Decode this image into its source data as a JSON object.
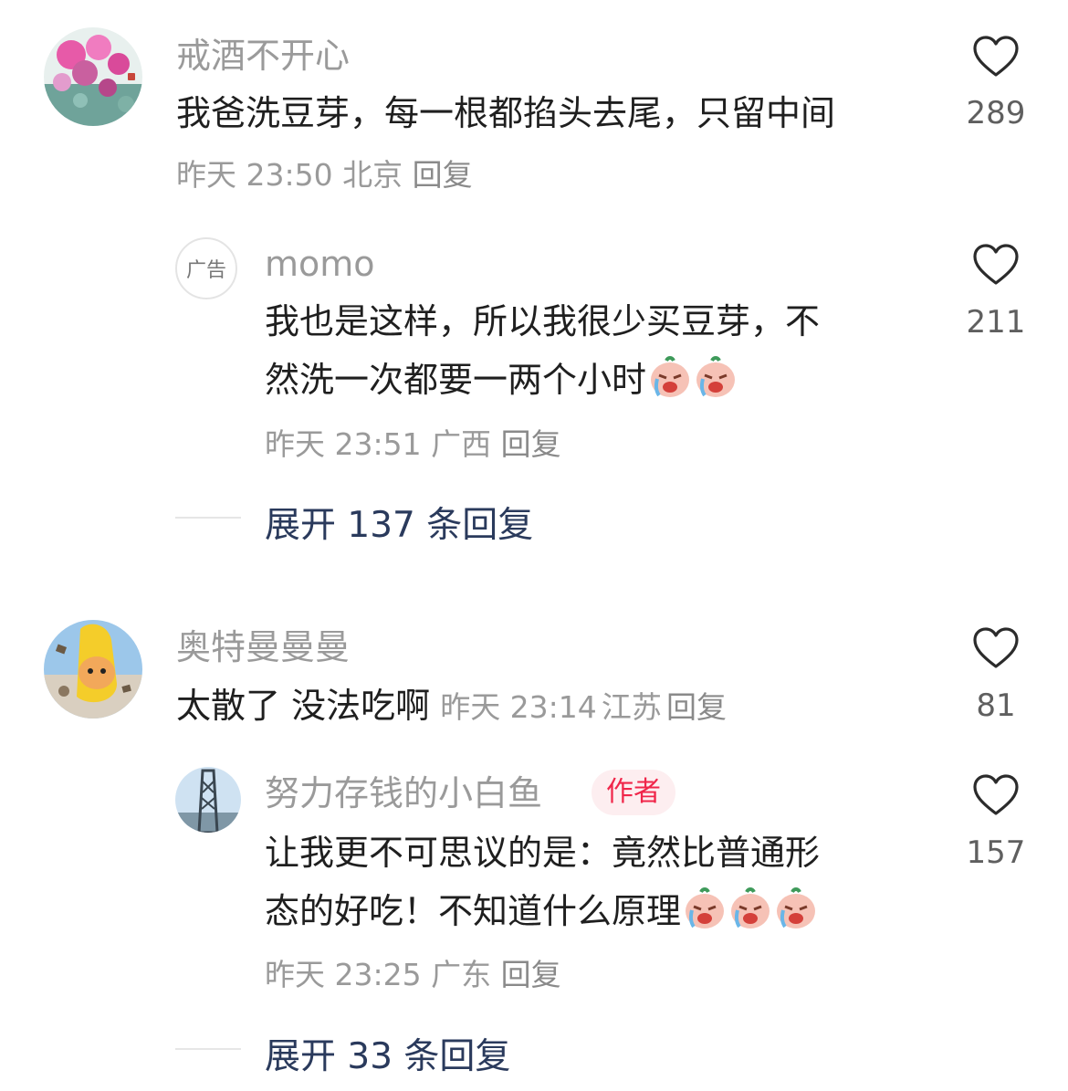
{
  "comments": [
    {
      "username": "戒酒不开心",
      "text": "我爸洗豆芽，每一根都掐头去尾，只留中间",
      "time": "昨天 23:50",
      "location": "北京",
      "reply_label": "回复",
      "likes": "289",
      "replies": [
        {
          "avatar_text": "广告",
          "username": "momo",
          "text_line1": "我也是这样，所以我很少买豆芽，不",
          "text_line2": "然洗一次都要一两个小时",
          "emojis": [
            "crying-face-emoji",
            "crying-face-emoji"
          ],
          "time": "昨天 23:51",
          "location": "广西",
          "reply_label": "回复",
          "likes": "211"
        }
      ],
      "expand_label": "展开 137 条回复"
    },
    {
      "username": "奥特曼曼曼",
      "text": "太散了 没法吃啊",
      "time": "昨天 23:14",
      "location": "江苏",
      "reply_label": "回复",
      "likes": "81",
      "replies": [
        {
          "username": "努力存钱的小白鱼",
          "badge": "作者",
          "text_line1": "让我更不可思议的是：竟然比普通形",
          "text_line2": "态的好吃！不知道什么原理",
          "emojis": [
            "crying-face-emoji",
            "crying-face-emoji",
            "crying-face-emoji"
          ],
          "time": "昨天 23:25",
          "location": "广东",
          "reply_label": "回复",
          "likes": "157"
        }
      ],
      "expand_label": "展开 33 条回复"
    }
  ],
  "colors": {
    "name": "#9a9a9a",
    "content": "#1f1f1f",
    "expand": "#2a3a5c",
    "author_badge": "#f0264a"
  },
  "icons": {
    "like": "heart-outline-icon",
    "emoji": "crying-face-emoji"
  }
}
